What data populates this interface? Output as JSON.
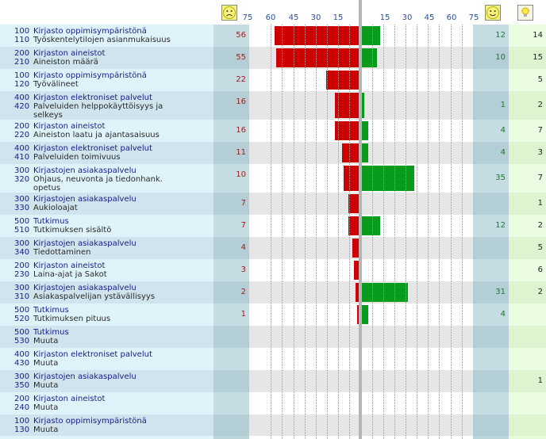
{
  "header": {
    "neg_ticks": [
      "75",
      "60",
      "45",
      "30",
      "15"
    ],
    "pos_ticks": [
      "15",
      "30",
      "45",
      "60",
      "75"
    ],
    "sad_face_icon": "sad-face-icon",
    "happy_face_icon": "happy-face-icon",
    "idea_icon": "lightbulb-icon"
  },
  "colors": {
    "cat_bg_a": "#dff3fa",
    "cat_bg_b": "#cfe4ec",
    "neg_col": "#b9d6dc",
    "pos_col": "#b9d6dc",
    "imp_col": "#e3fbd9",
    "neg_bar": "#cc0000",
    "pos_bar": "#099b1c"
  },
  "rows": [
    {
      "code1": "100",
      "label1": "Kirjasto oppimisympäristönä",
      "code2": "110",
      "label2": "Työskentelytilojen asianmukaisuus",
      "neg": "56",
      "pos": "12",
      "imp": "14",
      "negv": 56,
      "posv": 12
    },
    {
      "code1": "200",
      "label1": "Kirjaston aineistot",
      "code2": "210",
      "label2": "Aineiston määrä",
      "neg": "55",
      "pos": "10",
      "imp": "15",
      "negv": 55,
      "posv": 10
    },
    {
      "code1": "100",
      "label1": "Kirjasto oppimisympäristönä",
      "code2": "120",
      "label2": "Työvälineet",
      "neg": "22",
      "pos": "",
      "imp": "5",
      "negv": 22,
      "posv": 0
    },
    {
      "code1": "400",
      "label1": "Kirjaston elektroniset palvelut",
      "code2": "420",
      "label2": "Palveluiden helppokäyttöisyys ja selkeys",
      "neg": "16",
      "pos": "1",
      "imp": "2",
      "negv": 16,
      "posv": 1
    },
    {
      "code1": "200",
      "label1": "Kirjaston aineistot",
      "code2": "220",
      "label2": "Aineiston laatu ja ajantasaisuus",
      "neg": "16",
      "pos": "4",
      "imp": "7",
      "negv": 16,
      "posv": 4
    },
    {
      "code1": "400",
      "label1": "Kirjaston elektroniset palvelut",
      "code2": "410",
      "label2": "Palveluiden toimivuus",
      "neg": "11",
      "pos": "4",
      "imp": "3",
      "negv": 11,
      "posv": 4
    },
    {
      "code1": "300",
      "label1": "Kirjastojen asiakaspalvelu",
      "code2": "320",
      "label2": "Ohjaus, neuvonta ja tiedonhank. opetus",
      "neg": "10",
      "pos": "35",
      "imp": "7",
      "negv": 10,
      "posv": 35
    },
    {
      "code1": "300",
      "label1": "Kirjastojen asiakaspalvelu",
      "code2": "330",
      "label2": "Aukioloajat",
      "neg": "7",
      "pos": "",
      "imp": "1",
      "negv": 7,
      "posv": 0
    },
    {
      "code1": "500",
      "label1": "Tutkimus",
      "code2": "510",
      "label2": "Tutkimuksen sisältö",
      "neg": "7",
      "pos": "12",
      "imp": "2",
      "negv": 7,
      "posv": 12
    },
    {
      "code1": "300",
      "label1": "Kirjastojen asiakaspalvelu",
      "code2": "340",
      "label2": "Tiedottaminen",
      "neg": "4",
      "pos": "",
      "imp": "5",
      "negv": 4,
      "posv": 0
    },
    {
      "code1": "200",
      "label1": "Kirjaston aineistot",
      "code2": "230",
      "label2": "Laina-ajat ja Sakot",
      "neg": "3",
      "pos": "",
      "imp": "6",
      "negv": 3,
      "posv": 0
    },
    {
      "code1": "300",
      "label1": "Kirjastojen asiakaspalvelu",
      "code2": "310",
      "label2": "Asiakaspalvelijan ystävällisyys",
      "neg": "2",
      "pos": "31",
      "imp": "2",
      "negv": 2,
      "posv": 31
    },
    {
      "code1": "500",
      "label1": "Tutkimus",
      "code2": "520",
      "label2": "Tutkimuksen pituus",
      "neg": "1",
      "pos": "4",
      "imp": "",
      "negv": 1,
      "posv": 4
    },
    {
      "code1": "500",
      "label1": "Tutkimus",
      "code2": "530",
      "label2": "Muuta",
      "neg": "",
      "pos": "",
      "imp": "",
      "negv": 0,
      "posv": 0
    },
    {
      "code1": "400",
      "label1": "Kirjaston elektroniset palvelut",
      "code2": "430",
      "label2": "Muuta",
      "neg": "",
      "pos": "",
      "imp": "",
      "negv": 0,
      "posv": 0
    },
    {
      "code1": "300",
      "label1": "Kirjastojen asiakaspalvelu",
      "code2": "350",
      "label2": "Muuta",
      "neg": "",
      "pos": "",
      "imp": "1",
      "negv": 0,
      "posv": 0
    },
    {
      "code1": "200",
      "label1": "Kirjaston aineistot",
      "code2": "240",
      "label2": "Muuta",
      "neg": "",
      "pos": "",
      "imp": "",
      "negv": 0,
      "posv": 0
    },
    {
      "code1": "100",
      "label1": "Kirjasto oppimisympäristönä",
      "code2": "130",
      "label2": "Muuta",
      "neg": "",
      "pos": "",
      "imp": "",
      "negv": 0,
      "posv": 0
    }
  ]
}
